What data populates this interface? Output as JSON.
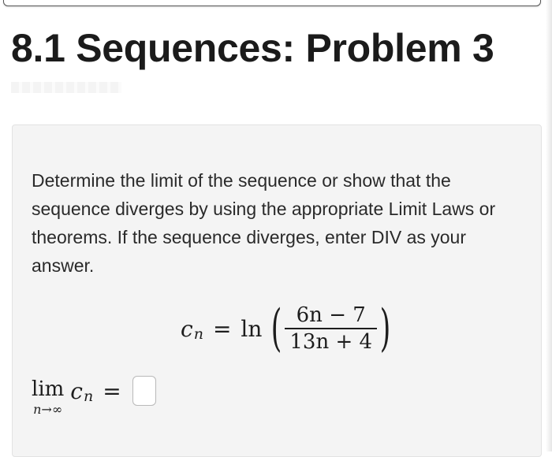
{
  "header": {
    "title": "8.1 Sequences: Problem 3"
  },
  "problem": {
    "instructions": "Determine the limit of the sequence or show that the sequence diverges by using the appropriate Limit Laws or theorems. If the sequence diverges, enter DIV as your answer.",
    "equation": {
      "variable": "c",
      "subscript": "n",
      "equals": "=",
      "function": "ln",
      "numerator": "6n − 7",
      "denominator": "13n + 4"
    },
    "limit": {
      "word": "lim",
      "under": "n→∞",
      "expression_var": "c",
      "expression_sub": "n",
      "equals": "="
    }
  },
  "answer": {
    "value": ""
  }
}
